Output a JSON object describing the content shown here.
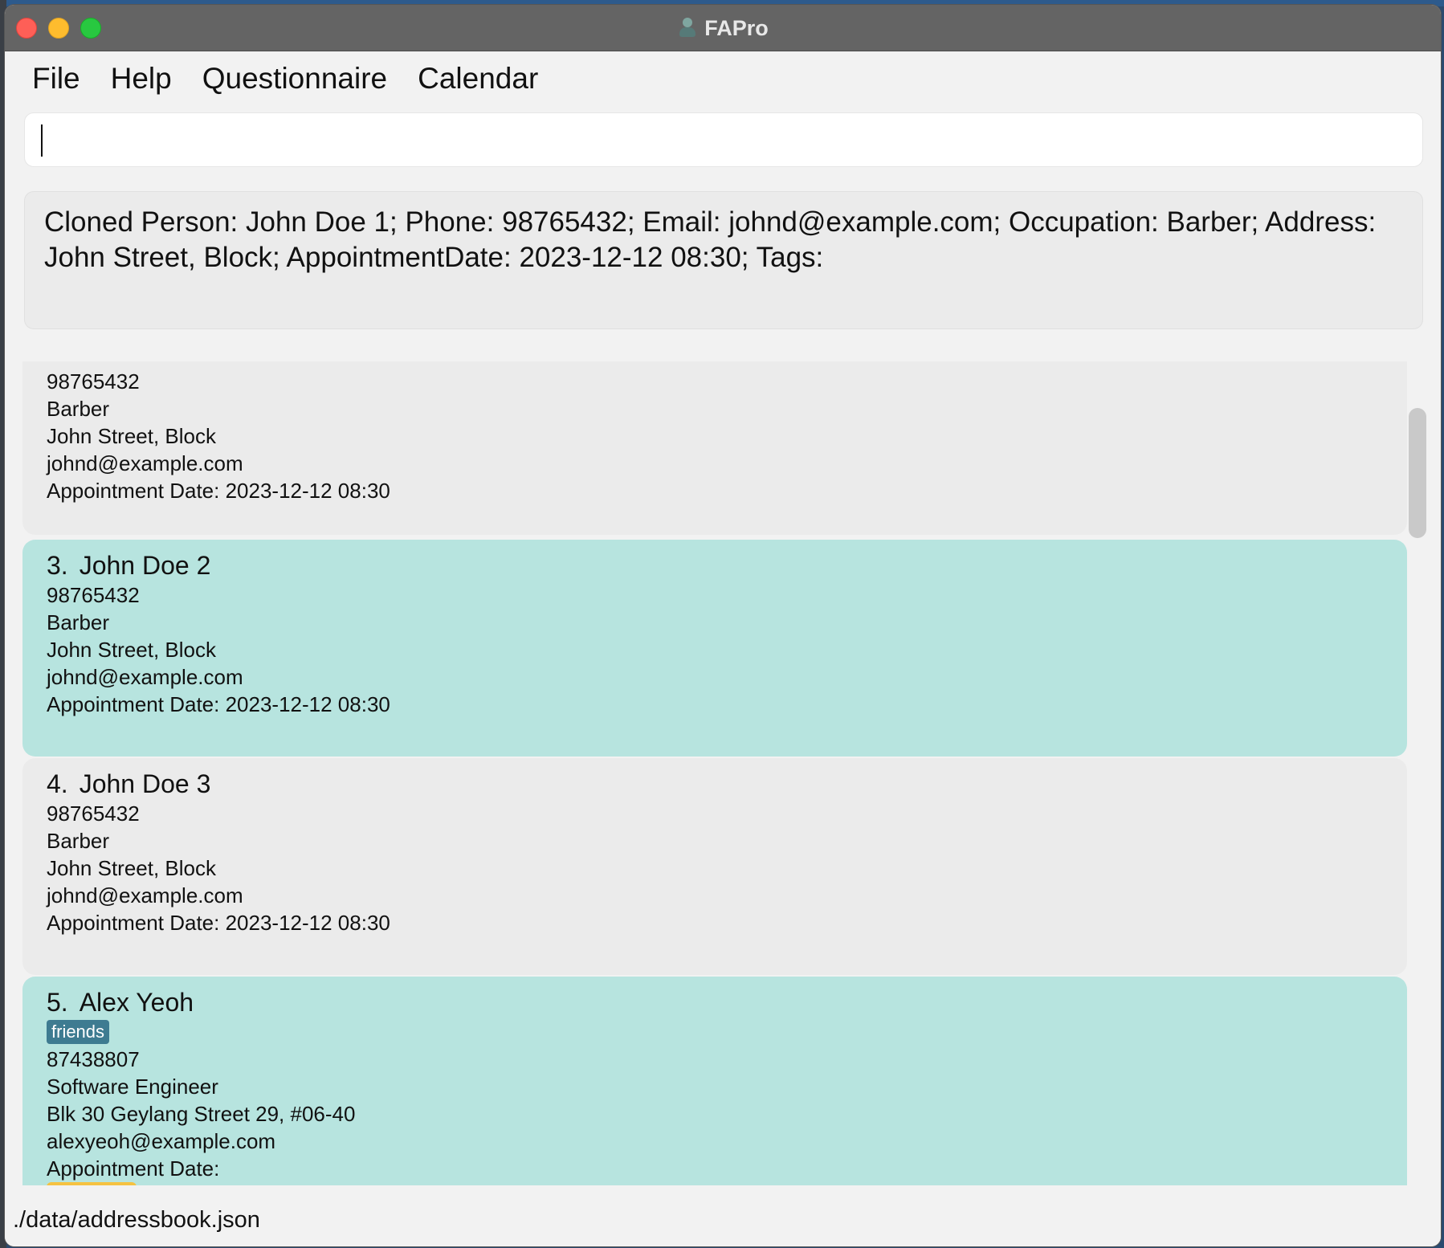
{
  "window": {
    "title": "FAPro"
  },
  "menu": {
    "items": [
      "File",
      "Help",
      "Questionnaire",
      "Calendar"
    ]
  },
  "command": {
    "value": "",
    "placeholder": ""
  },
  "result": {
    "text": "Cloned Person: John Doe 1; Phone: 98765432; Email: johnd@example.com; Occupation: Barber; Address: John Street, Block; AppointmentDate: 2023-12-12 08:30; Tags:"
  },
  "persons": [
    {
      "phone": "98765432",
      "occupation": "Barber",
      "address": "John Street, Block",
      "email": "johnd@example.com",
      "appointment": "Appointment Date: 2023-12-12 08:30"
    },
    {
      "index": "3.",
      "name": "John Doe 2",
      "phone": "98765432",
      "occupation": "Barber",
      "address": "John Street, Block",
      "email": "johnd@example.com",
      "appointment": "Appointment Date: 2023-12-12 08:30"
    },
    {
      "index": "4.",
      "name": "John Doe 3",
      "phone": "98765432",
      "occupation": "Barber",
      "address": "John Street, Block",
      "email": "johnd@example.com",
      "appointment": "Appointment Date: 2023-12-12 08:30"
    },
    {
      "index": "5.",
      "name": "Alex Yeoh",
      "tag": "friends",
      "phone": "87438807",
      "occupation": "Software Engineer",
      "address": "Blk 30 Geylang Street 29, #06-40",
      "email": "alexyeoh@example.com",
      "appointment": "Appointment Date:"
    }
  ],
  "status": {
    "path": "./data/addressbook.json"
  },
  "colors": {
    "teal_card": "#b7e4df",
    "grey_card": "#ebebeb",
    "tag_friends": "#3e7b91",
    "close": "#fe5f57",
    "minimize": "#febc2e",
    "maximize": "#28c840"
  }
}
